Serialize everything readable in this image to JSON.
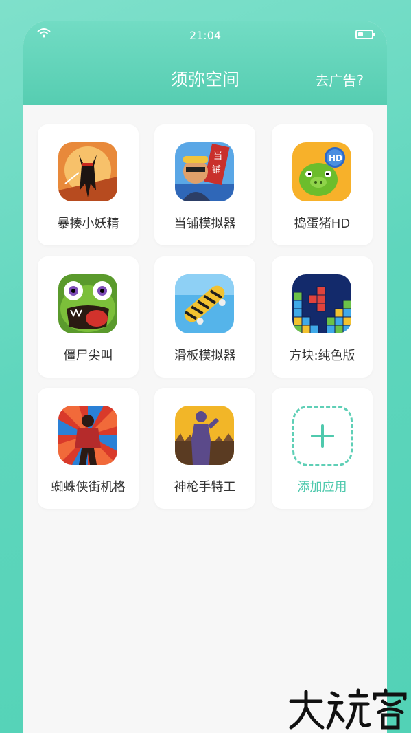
{
  "status_bar": {
    "time": "21:04"
  },
  "header": {
    "title": "须弥空间",
    "remove_ads": "去广告?"
  },
  "apps": [
    {
      "name": "暴揍小妖精",
      "icon": "ninja-fighter-icon"
    },
    {
      "name": "当铺模拟器",
      "icon": "pawn-shop-icon"
    },
    {
      "name": "捣蛋猪HD",
      "icon": "green-pig-icon"
    },
    {
      "name": "僵尸尖叫",
      "icon": "zombie-face-icon"
    },
    {
      "name": "滑板模拟器",
      "icon": "skateboard-icon"
    },
    {
      "name": "方块:纯色版",
      "icon": "block-puzzle-icon"
    },
    {
      "name": "蜘蛛侠街机格",
      "icon": "spider-hero-icon"
    },
    {
      "name": "神枪手特工",
      "icon": "gunman-silhouette-icon"
    }
  ],
  "add_app_label": "添加应用",
  "watermark": "大玩客",
  "colors": {
    "accent": "#56cdb1",
    "add_text": "#4fc9ad",
    "background": "#f7f7f7"
  }
}
